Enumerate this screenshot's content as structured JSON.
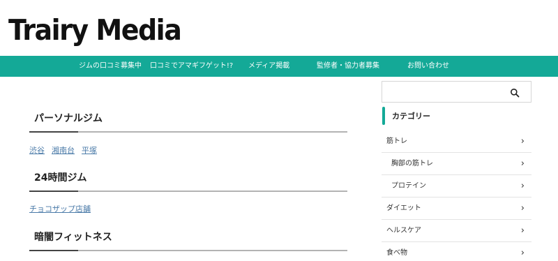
{
  "site": {
    "logo": "Trairy Media"
  },
  "nav": {
    "items": [
      {
        "label": "ジムの口コミ募集中"
      },
      {
        "label": "口コミでアマギフゲット!?"
      },
      {
        "label": "メディア掲載"
      },
      {
        "label": "監修者・協力者募集"
      },
      {
        "label": "お問い合わせ"
      }
    ]
  },
  "main": {
    "sections": [
      {
        "title": "パーソナルジム",
        "tags": [
          "渋谷",
          "湘南台",
          "平塚"
        ]
      },
      {
        "title": "24時間ジム",
        "tags": [
          "チョコザップ店舗"
        ]
      },
      {
        "title": "暗闇フィットネス",
        "tags": []
      }
    ]
  },
  "sidebar": {
    "search": {
      "placeholder": "",
      "icon": "search-icon"
    },
    "category_heading": "カテゴリー",
    "categories": [
      {
        "label": "筋トレ",
        "sub": false
      },
      {
        "label": "胸部の筋トレ",
        "sub": true
      },
      {
        "label": "プロテイン",
        "sub": true
      },
      {
        "label": "ダイエット",
        "sub": false
      },
      {
        "label": "ヘルスケア",
        "sub": false
      },
      {
        "label": "食べ物",
        "sub": false
      }
    ],
    "chevron": "›"
  },
  "colors": {
    "accent": "#14a997",
    "link": "#4a7aa8",
    "heading_line": "#b3b3b3",
    "heading_accent": "#444444"
  }
}
